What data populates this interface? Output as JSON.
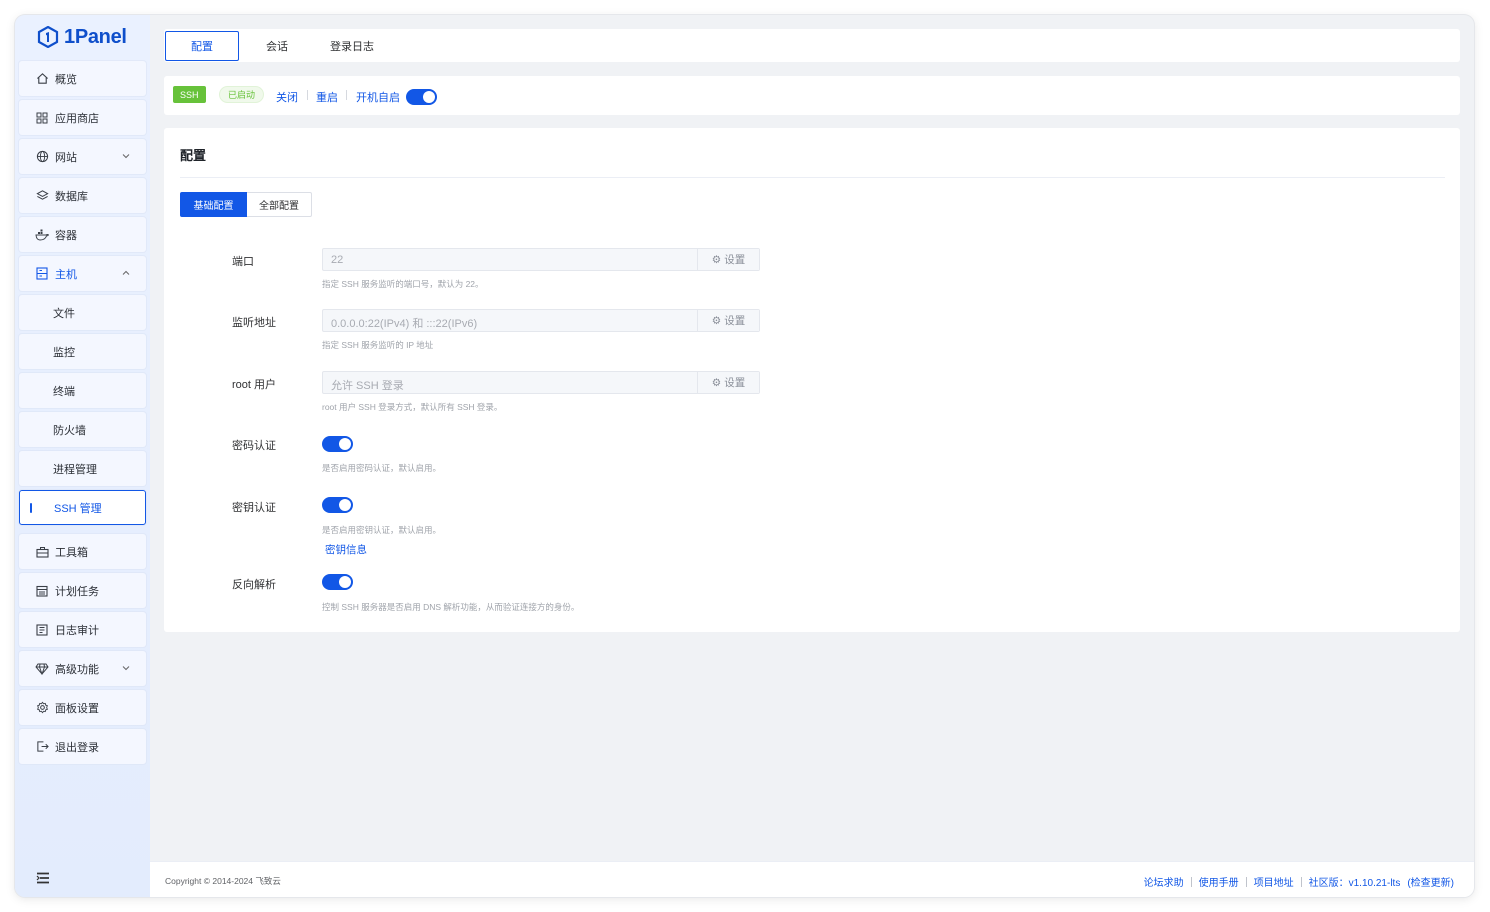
{
  "app": {
    "logo_text": "1Panel"
  },
  "sidebar": {
    "items": [
      {
        "label": "概览",
        "icon": "home-icon"
      },
      {
        "label": "应用商店",
        "icon": "grid-icon"
      },
      {
        "label": "网站",
        "icon": "globe-icon",
        "expandable": true
      },
      {
        "label": "数据库",
        "icon": "layers-icon"
      },
      {
        "label": "容器",
        "icon": "docker-icon"
      },
      {
        "label": "主机",
        "icon": "server-icon",
        "expandable": true,
        "expanded": true
      },
      {
        "label": "文件"
      },
      {
        "label": "监控"
      },
      {
        "label": "终端"
      },
      {
        "label": "防火墙"
      },
      {
        "label": "进程管理"
      },
      {
        "label": "SSH 管理",
        "active": true
      },
      {
        "label": "工具箱",
        "icon": "toolbox-icon"
      },
      {
        "label": "计划任务",
        "icon": "calendar-icon"
      },
      {
        "label": "日志审计",
        "icon": "log-icon"
      },
      {
        "label": "高级功能",
        "icon": "diamond-icon",
        "expandable": true
      },
      {
        "label": "面板设置",
        "icon": "gear-icon"
      },
      {
        "label": "退出登录",
        "icon": "logout-icon"
      }
    ]
  },
  "tabs": [
    {
      "label": "配置",
      "active": true
    },
    {
      "label": "会话"
    },
    {
      "label": "登录日志"
    }
  ],
  "status": {
    "service_tag": "SSH",
    "state_tag": "已启动",
    "stop_label": "关闭",
    "restart_label": "重启",
    "autostart_label": "开机自启",
    "autostart_on": true
  },
  "config": {
    "title": "配置",
    "segments": {
      "basic": "基础配置",
      "all": "全部配置"
    },
    "set_button": "设置",
    "fields": {
      "port": {
        "label": "端口",
        "value": "22",
        "help": "指定 SSH 服务监听的端口号，默认为 22。"
      },
      "listen": {
        "label": "监听地址",
        "value": "0.0.0.0:22(IPv4) 和 :::22(IPv6)",
        "help": "指定 SSH 服务监听的 IP 地址"
      },
      "root": {
        "label": "root 用户",
        "value": "允许 SSH 登录",
        "help": "root 用户 SSH 登录方式，默认所有 SSH 登录。"
      },
      "password_auth": {
        "label": "密码认证",
        "on": true,
        "help": "是否启用密码认证，默认启用。"
      },
      "key_auth": {
        "label": "密钥认证",
        "on": true,
        "help": "是否启用密钥认证，默认启用。",
        "link": "密钥信息"
      },
      "reverse_dns": {
        "label": "反向解析",
        "on": true,
        "help": "控制 SSH 服务器是否启用 DNS 解析功能，从而验证连接方的身份。"
      }
    }
  },
  "footer": {
    "copyright": "Copyright © 2014-2024 飞致云",
    "forum": "论坛求助",
    "manual": "使用手册",
    "project": "项目地址",
    "edition": "社区版：",
    "version": "v1.10.21-lts",
    "check_update": "(检查更新)"
  },
  "colors": {
    "accent": "#1257e6",
    "success": "#67c23a",
    "sidebar_bg": "#e3ecfd"
  }
}
